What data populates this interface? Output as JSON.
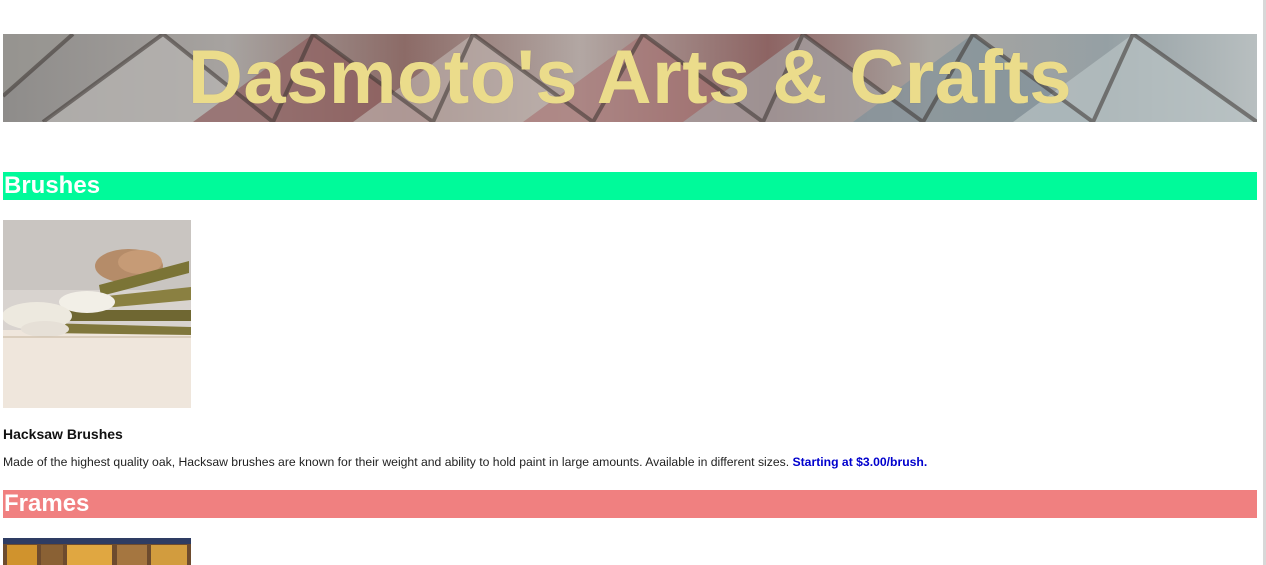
{
  "header": {
    "title": "Dasmoto's Arts & Crafts"
  },
  "sections": [
    {
      "heading": "Brushes",
      "color": "#00fa9a",
      "product": {
        "name": "Hacksaw Brushes",
        "description": "Made of the highest quality oak, Hacksaw brushes are known for their weight and ability to hold paint in large amounts. Available in different sizes.",
        "price": "Starting at $3.00/brush."
      }
    },
    {
      "heading": "Frames",
      "color": "#f08080"
    }
  ],
  "colors": {
    "title_text": "#ebdc8b",
    "price_text": "#0000cd"
  }
}
